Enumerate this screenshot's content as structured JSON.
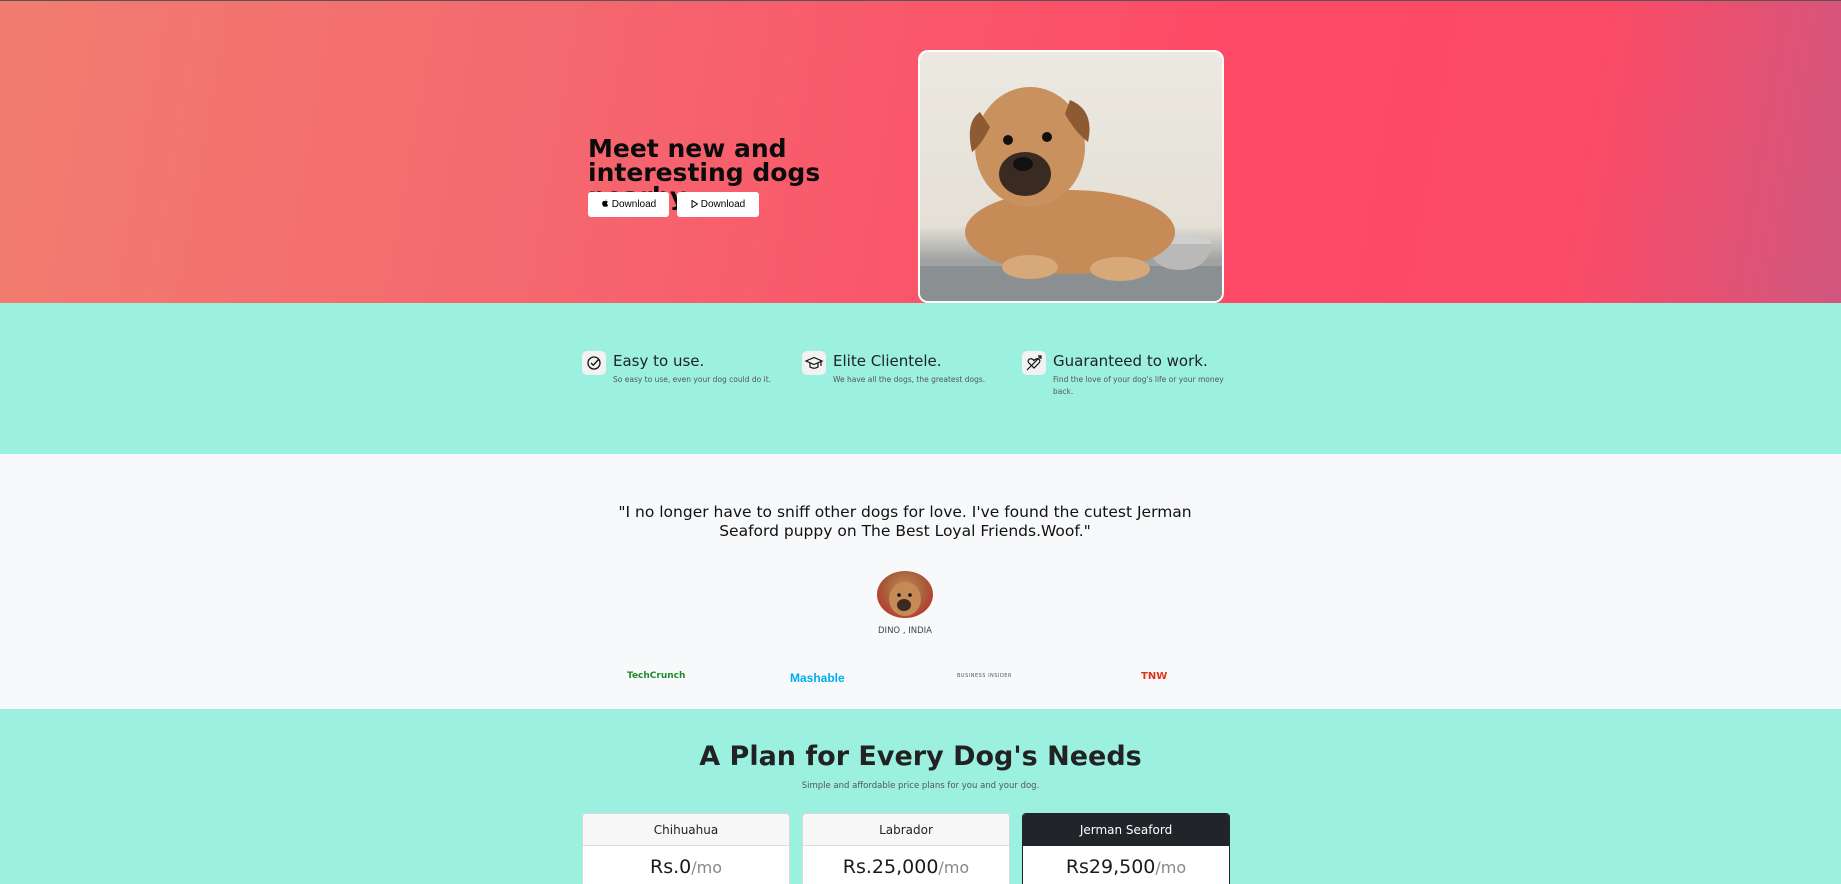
{
  "hero": {
    "title": "Meet new and interesting dogs nearby.",
    "download_apple_label": "Download",
    "download_play_label": "Download",
    "photo_alt": "puppy"
  },
  "features": [
    {
      "icon": "check-circle-icon",
      "title": "Easy to use.",
      "description": "So easy to use, even your dog could do it."
    },
    {
      "icon": "graduation-cap-icon",
      "title": "Elite Clientele.",
      "description": "We have all the dogs, the greatest dogs."
    },
    {
      "icon": "heart-arrow-icon",
      "title": "Guaranteed to work.",
      "description": "Find the love of your dog's life or your money back."
    }
  ],
  "testimonial": {
    "quote": "\"I no longer have to sniff other dogs for love. I've found the cutest Jerman Seaford puppy on The Best Loyal Friends.Woof.\"",
    "author": "DINO , INDIA"
  },
  "press_logos": [
    "TechCrunch",
    "Mashable",
    "BUSINESS INSIDER",
    "TNW"
  ],
  "pricing": {
    "title": "A Plan for Every Dog's Needs",
    "subtitle": "Simple and affordable price plans for you and your dog.",
    "plans": [
      {
        "name": "Chihuahua",
        "price": "Rs.0",
        "period": "/mo"
      },
      {
        "name": "Labrador",
        "price": "Rs.25,000",
        "period": "/mo"
      },
      {
        "name": "Jerman Seaford",
        "price": "Rs29,500",
        "period": "/mo"
      }
    ]
  },
  "colors": {
    "hero_gradient_start": "#f27d6f",
    "hero_gradient_end": "#fe4a66",
    "mint": "#9cf0e0",
    "dark_card": "#212529"
  }
}
